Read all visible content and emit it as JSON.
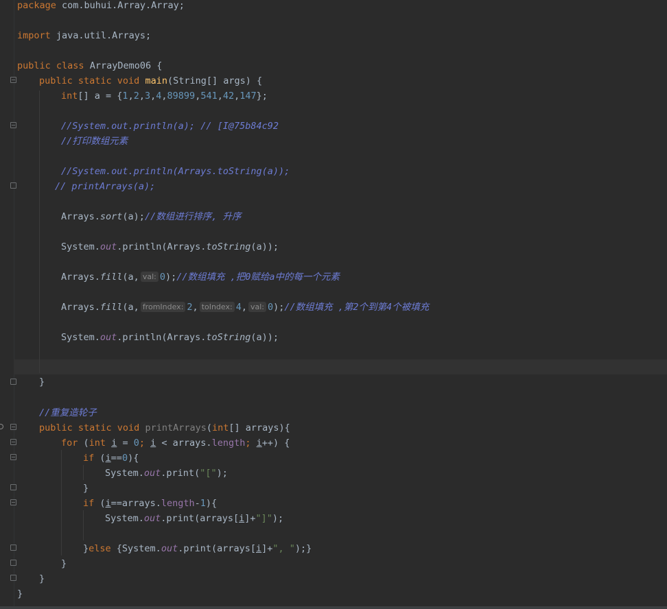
{
  "code": {
    "l_package": "package",
    "l_package_rest": " com.buhui.Array.Array;",
    "l_import": "import",
    "l_import_rest": " java.util.Arrays;",
    "l_class_public": "public",
    "l_class_class": "class",
    "l_class_rest": " ArrayDemo06 {",
    "main_sig_kw": "public static void",
    "main_name": "main",
    "main_args": "(String[] args) {",
    "arr_type": "int",
    "arr_decl": "[] a = {",
    "arr_values": [
      "1",
      "2",
      "3",
      "4",
      "89899",
      "541",
      "42",
      "147"
    ],
    "arr_end": "};",
    "comment1": "//System.out.println(a); // [I@75b84c92",
    "comment2": "//打印数组元素",
    "comment3": "//System.out.println(Arrays.toString(a));",
    "comment4": "// printArrays(a);",
    "sort_pre": "Arrays.",
    "sort_name": "sort",
    "sort_args": "(a);",
    "sort_comment": "//数组进行排序, 升序",
    "println_pre": "System.",
    "println_out": "out",
    "println_mid": ".println(Arrays.",
    "println_tostring": "toString",
    "println_end": "(a));",
    "fill_pre": "Arrays.",
    "fill_name": "fill",
    "fill1_open": "(a,",
    "hint_val": "val:",
    "fill1_val": "0",
    "fill1_close": ");",
    "fill1_comment": "//数组填充 ,把0赋给a中的每一个元素",
    "hint_from": "fromIndex:",
    "hint_to": "toIndex:",
    "fill2_from": "2",
    "fill2_to": "4",
    "fill2_val": "0",
    "fill2_comment": "//数组填充 ,第2个到第4个被填充",
    "close_brace": "}",
    "comment_reinvent": "//重复造轮子",
    "pa_sig_kw": "public static void",
    "pa_name": "printArrays",
    "pa_open": "(",
    "pa_int": "int",
    "pa_args": "[] arrays){",
    "for_kw": "for",
    "for_int": "int",
    "var_i": "i",
    "for_eq": " = ",
    "for_zero": "0",
    "for_lt": " < arrays.",
    "for_length": "length",
    "for_inc": "++) {",
    "if_kw": "if",
    "if1_cond": "==",
    "if1_zero": "0",
    "if1_end": "){",
    "print_pre": "System.",
    "print_out": "out",
    "print_mid": ".print(",
    "print_open_str": "\"[\"",
    "print_end": ");",
    "if2_mid": "==arrays.",
    "if2_length": "length",
    "if2_minus": "-",
    "if2_one": "1",
    "if2_end": "){",
    "print2_args_a": ".print(arrays[",
    "print2_args_b": "]+",
    "print2_str": "\"]\"",
    "else_kw": "else",
    "else_open": " {System.",
    "else_str": "\", \"",
    "else_end": ");}"
  },
  "colors": {
    "background": "#2b2b2b",
    "keyword": "#cc7832",
    "method": "#ffc66d",
    "number": "#6897bb",
    "string": "#6a8759",
    "comment": "#6d7cd4",
    "field": "#9876aa",
    "text": "#a9b7c6"
  }
}
